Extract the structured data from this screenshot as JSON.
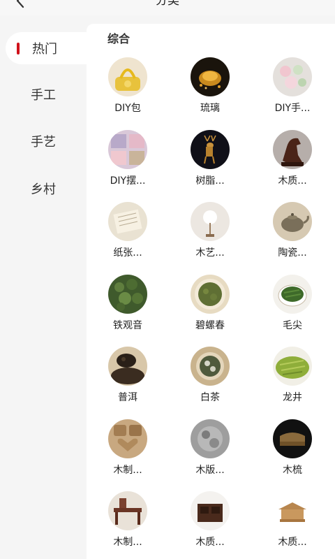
{
  "header": {
    "title": "分类"
  },
  "sidebar": {
    "items": [
      {
        "label": "热门",
        "active": true
      },
      {
        "label": "手工",
        "active": false
      },
      {
        "label": "手艺",
        "active": false
      },
      {
        "label": "乡村",
        "active": false
      }
    ],
    "accent": "#d0121b"
  },
  "section": {
    "title": "综合"
  },
  "categories": [
    {
      "label": "DIY包",
      "icon": "crochet-bag-photo"
    },
    {
      "label": "琉璃",
      "icon": "glass-ornament-photo"
    },
    {
      "label": "DIY手...",
      "icon": "handmade-flowers-photo"
    },
    {
      "label": "DIY摆...",
      "icon": "diy-ornaments-photo"
    },
    {
      "label": "树脂...",
      "icon": "resin-deer-photo"
    },
    {
      "label": "木质...",
      "icon": "wooden-horse-photo"
    },
    {
      "label": "纸张...",
      "icon": "paper-scroll-photo"
    },
    {
      "label": "木艺...",
      "icon": "wood-art-photo"
    },
    {
      "label": "陶瓷...",
      "icon": "ceramic-teapot-photo"
    },
    {
      "label": "铁观音",
      "icon": "tieguanyin-tea-photo"
    },
    {
      "label": "碧螺春",
      "icon": "biluochun-tea-photo"
    },
    {
      "label": "毛尖",
      "icon": "maojian-tea-photo"
    },
    {
      "label": "普洱",
      "icon": "puer-tea-photo"
    },
    {
      "label": "白茶",
      "icon": "white-tea-photo"
    },
    {
      "label": "龙井",
      "icon": "longjing-tea-photo"
    },
    {
      "label": "木制...",
      "icon": "wooden-molds-photo"
    },
    {
      "label": "木版...",
      "icon": "woodblock-photo"
    },
    {
      "label": "木梳",
      "icon": "wooden-comb-photo"
    },
    {
      "label": "木制...",
      "icon": "wooden-furniture-photo"
    },
    {
      "label": "木质...",
      "icon": "wooden-box-photo"
    },
    {
      "label": "木质...",
      "icon": "wooden-pavilion-photo"
    }
  ]
}
